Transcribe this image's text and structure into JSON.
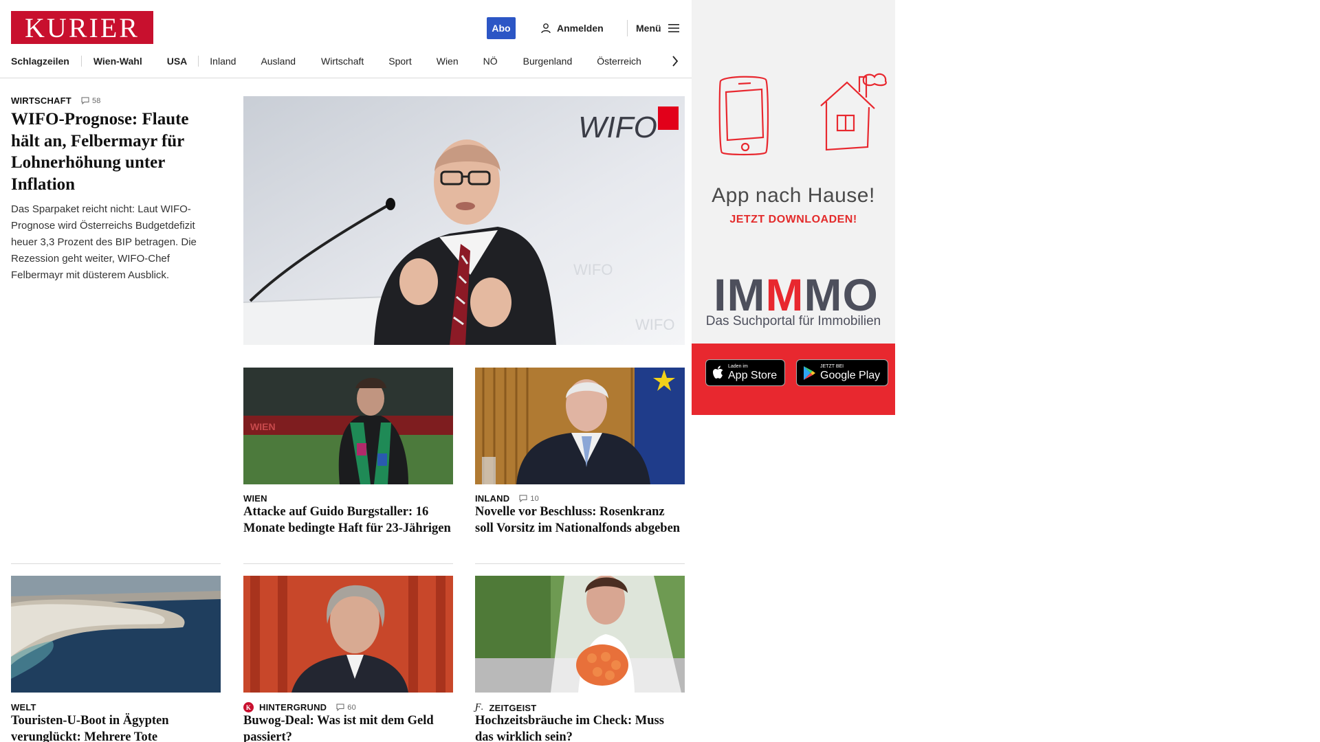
{
  "header": {
    "logo": "KURIER",
    "abo": "Abo",
    "login": "Anmelden",
    "menu": "Menü"
  },
  "nav": [
    "Schlagzeilen",
    "Wien-Wahl",
    "USA",
    "Inland",
    "Ausland",
    "Wirtschaft",
    "Sport",
    "Wien",
    "NÖ",
    "Burgenland",
    "Österreich"
  ],
  "lead": {
    "category": "WIRTSCHAFT",
    "comments": "58",
    "headline": "WIFO-Prognose: Flaute hält an, Felbermayr für Lohnerhöhung unter Inflation",
    "teaser": "Das Sparpaket reicht nicht: Laut WIFO-Prognose wird Österreichs Budgetdefizit heuer 3,3 Prozent des BIP betragen. Die Rezession geht weiter, WIFO-Chef Felbermayr mit düsterem Ausblick.",
    "image_logo": "WIFO"
  },
  "cards": [
    {
      "category": "WIEN",
      "comments": "",
      "headline": "Attacke auf Guido Burgstaller: 16 Monate bedingte Haft für 23-Jährigen"
    },
    {
      "category": "INLAND",
      "comments": "10",
      "headline": "Novelle vor Beschluss: Rosenkranz soll Vorsitz im Nationalfonds abgeben"
    },
    {
      "category": "WELT",
      "comments": "",
      "headline": "Touristen-U-Boot in Ägypten verunglückt: Mehrere Tote"
    },
    {
      "category": "HINTERGRUND",
      "comments": "60",
      "headline": "Buwog-Deal: Was ist mit dem Geld passiert?"
    },
    {
      "category": "ZEITGEIST",
      "comments": "",
      "headline": "Hochzeitsbräuche im Check: Muss das wirklich sein?"
    }
  ],
  "ad": {
    "title": "App nach Hause!",
    "subtitle": "JETZT DOWNLOADEN!",
    "brand_a": "IM",
    "brand_b": "M",
    "brand_c": "MO",
    "brand_sub": "Das Suchportal für Immobilien",
    "appstore_small": "Laden im",
    "appstore_big": "App Store",
    "googleplay_small": "JETZT BEI",
    "googleplay_big": "Google Play"
  },
  "colors": {
    "brand_red": "#c8102e",
    "abo_blue": "#2c56c5",
    "ad_red": "#e8282f"
  }
}
